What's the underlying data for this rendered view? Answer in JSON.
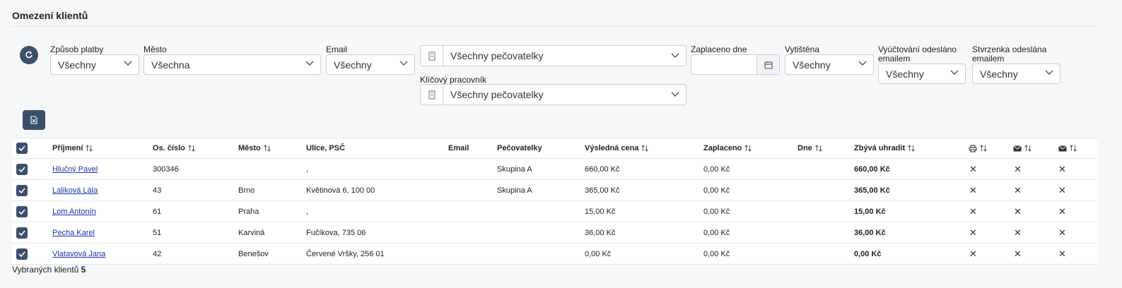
{
  "page": {
    "title": "Omezení klientů"
  },
  "filters": {
    "zpusob_platby": {
      "label": "Způsob platby",
      "value": "Všechny"
    },
    "mesto": {
      "label": "Město",
      "value": "Všechna"
    },
    "email": {
      "label": "Email",
      "value": "Všechny"
    },
    "pecovatelky": {
      "value": "Všechny pečovatelky"
    },
    "klicovy_pracovnik": {
      "label": "Klíčový pracovník",
      "value": "Všechny pečovatelky"
    },
    "zaplaceno_dne": {
      "label": "Zaplaceno dne",
      "value": ""
    },
    "vytistena": {
      "label": "Vytištěna",
      "value": "Všechny"
    },
    "vyuctovani_odeslano": {
      "label_line1": "Vyúčtování odesláno",
      "label_line2": "emailem",
      "value": "Všechny"
    },
    "stvrzenka_odeslana": {
      "label_line1": "Stvrzenka odeslána",
      "label_line2": "emailem",
      "value": "Všechny"
    }
  },
  "table": {
    "headers": {
      "prijmeni": "Příjmení",
      "os_cislo": "Os. číslo",
      "mesto": "Město",
      "ulice": "Ulice, PSČ",
      "email": "Email",
      "pecovatelky": "Pečovatelky",
      "vysledna_cena": "Výsledná cena",
      "zaplaceno": "Zaplaceno",
      "dne": "Dne",
      "zbyva": "Zbývá uhradit"
    },
    "rows": [
      {
        "name": "Hlučný Pavel",
        "os_cislo": "300346",
        "mesto": "",
        "ulice": ",",
        "email": "",
        "pecovatelky": "Skupina A",
        "cena": "660,00 Kč",
        "zaplaceno": "0,00 Kč",
        "dne": "",
        "zbyva": "660,00 Kč",
        "x": "✕"
      },
      {
        "name": "Laliková Lála",
        "os_cislo": "43",
        "mesto": "Brno",
        "ulice": "Květinová 6, 100 00",
        "email": "",
        "pecovatelky": "Skupina A",
        "cena": "365,00 Kč",
        "zaplaceno": "0,00 Kč",
        "dne": "",
        "zbyva": "365,00 Kč",
        "x": "✕"
      },
      {
        "name": "Lom Antonín",
        "os_cislo": "61",
        "mesto": "Praha",
        "ulice": ",",
        "email": "",
        "pecovatelky": "",
        "cena": "15,00 Kč",
        "zaplaceno": "0,00 Kč",
        "dne": "",
        "zbyva": "15,00 Kč",
        "x": "✕"
      },
      {
        "name": "Pecha Karel",
        "os_cislo": "51",
        "mesto": "Karviná",
        "ulice": "Fučíkova, 735 06",
        "email": "",
        "pecovatelky": "",
        "cena": "36,00 Kč",
        "zaplaceno": "0,00 Kč",
        "dne": "",
        "zbyva": "36,00 Kč",
        "x": "✕"
      },
      {
        "name": "Vlatavová Jana",
        "os_cislo": "42",
        "mesto": "Benešov",
        "ulice": "Červené Vršky, 256 01",
        "email": "",
        "pecovatelky": "",
        "cena": "0,00 Kč",
        "zaplaceno": "0,00 Kč",
        "dne": "",
        "zbyva": "0,00 Kč",
        "x": "✕"
      }
    ]
  },
  "footer": {
    "label": "Vybraných klientů",
    "count": "5"
  },
  "colors": {
    "primary": "#3b4f6b",
    "link": "#1a33a8",
    "border": "#c9cfd6",
    "background": "#f6f7f9"
  }
}
